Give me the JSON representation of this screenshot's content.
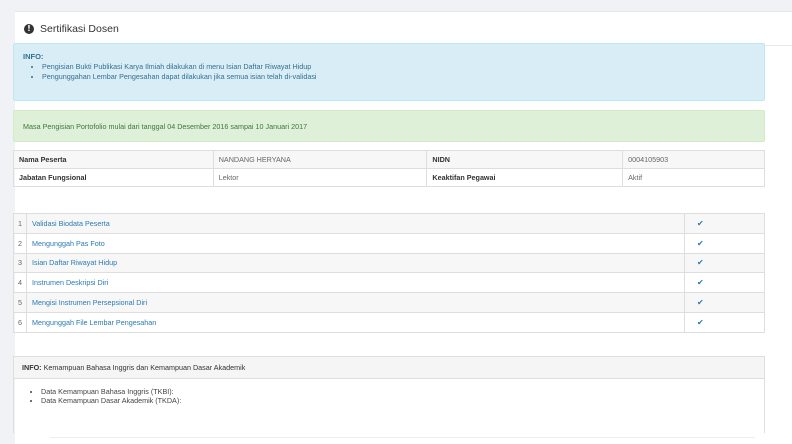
{
  "header": {
    "title": "Sertifikasi Dosen",
    "icon": "info-circle-icon"
  },
  "info_alert": {
    "title": "INFO:",
    "items": [
      "Pengisian Bukti Publikasi Karya Ilmiah dilakukan di menu Isian Daftar Riwayat Hidup",
      "Pengunggahan Lembar Pengesahan dapat dilakukan jika semua isian telah di-validasi"
    ]
  },
  "success_alert": {
    "text": "Masa Pengisian Portofolio mulai dari tanggal 04 Desember 2016 sampai 10 Januari 2017"
  },
  "profile": {
    "nama_label": "Nama Peserta",
    "nama_value": "NANDANG HERYANA",
    "nidn_label": "NIDN",
    "nidn_value": "0004105903",
    "jabatan_label": "Jabatan Fungsional",
    "jabatan_value": "Lektor",
    "keaktifan_label": "Keaktifan Pegawai",
    "keaktifan_value": "Aktif"
  },
  "steps": [
    {
      "num": "1",
      "label": "Validasi Biodata Peserta",
      "check": "✔"
    },
    {
      "num": "2",
      "label": "Mengunggah Pas Foto",
      "check": "✔"
    },
    {
      "num": "3",
      "label": "Isian Daftar Riwayat Hidup",
      "check": "✔"
    },
    {
      "num": "4",
      "label": "Instrumen Deskripsi Diri",
      "check": "✔"
    },
    {
      "num": "5",
      "label": "Mengisi Instrumen Persepsional Diri",
      "check": "✔"
    },
    {
      "num": "6",
      "label": "Mengunggah File Lembar Pengesahan",
      "check": "✔"
    }
  ],
  "info_panel": {
    "title_bold": "INFO:",
    "title_rest": "Kemampuan Bahasa Inggris dan Kemampuan Dasar Akademik",
    "items": [
      "Data Kemampuan Bahasa Inggris (TKBI):",
      "Data Kemampuan Dasar Akademik (TKDA):"
    ]
  },
  "colors": {
    "link": "#2a7ab0",
    "info_bg": "#d9edf7",
    "success_bg": "#dff0d8"
  }
}
